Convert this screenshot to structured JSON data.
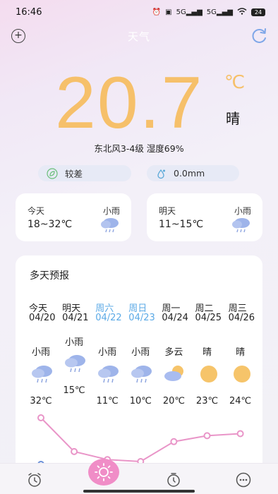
{
  "status_bar": {
    "time": "16:46",
    "icons": [
      "alarm-icon",
      "hd-icon",
      "signal-5g-icon",
      "signal-5g-icon",
      "wifi-icon"
    ],
    "net1": "5G",
    "net2": "5G",
    "battery": "24"
  },
  "header": {
    "title": "天气"
  },
  "current": {
    "temperature": "20.7",
    "unit": "℃",
    "weather": "晴",
    "wind_humidity": "东北风3-4级 湿度69%"
  },
  "indicators": {
    "air_quality": "较差",
    "precipitation": "0.0mm"
  },
  "today": {
    "label": "今天",
    "weather": "小雨",
    "range": "18~32℃"
  },
  "tomorrow": {
    "label": "明天",
    "weather": "小雨",
    "range": "11~15℃"
  },
  "forecast": {
    "title": "多天预报",
    "days": [
      {
        "day": "今天",
        "date": "04/20",
        "weather": "小雨",
        "icon": "light-rain-icon",
        "temp": "32℃",
        "weekend": false
      },
      {
        "day": "明天",
        "date": "04/21",
        "weather": "小雨",
        "icon": "light-rain-icon",
        "temp": "15℃",
        "weekend": false
      },
      {
        "day": "周六",
        "date": "04/22",
        "weather": "小雨",
        "icon": "light-rain-icon",
        "temp": "11℃",
        "weekend": true
      },
      {
        "day": "周日",
        "date": "04/23",
        "weather": "小雨",
        "icon": "light-rain-icon",
        "temp": "10℃",
        "weekend": true
      },
      {
        "day": "周一",
        "date": "04/24",
        "weather": "多云",
        "icon": "cloudy-sun-icon",
        "temp": "20℃",
        "weekend": false
      },
      {
        "day": "周二",
        "date": "04/25",
        "weather": "晴",
        "icon": "sunny-icon",
        "temp": "23℃",
        "weekend": false
      },
      {
        "day": "周三",
        "date": "04/26",
        "weather": "晴",
        "icon": "sunny-icon",
        "temp": "24℃",
        "weekend": false
      }
    ]
  },
  "colors": {
    "temp_accent": "#f6c06a",
    "weekend_text": "#5aa9e6",
    "high_line": "#e995c8",
    "low_line": "#6a8fd8",
    "nav_active": "#f08dc7"
  },
  "bottom_nav": {
    "items": [
      "alarm-clock-icon",
      "weather-sun-icon",
      "timer-icon",
      "more-icon"
    ],
    "active": "weather-sun-icon"
  }
}
